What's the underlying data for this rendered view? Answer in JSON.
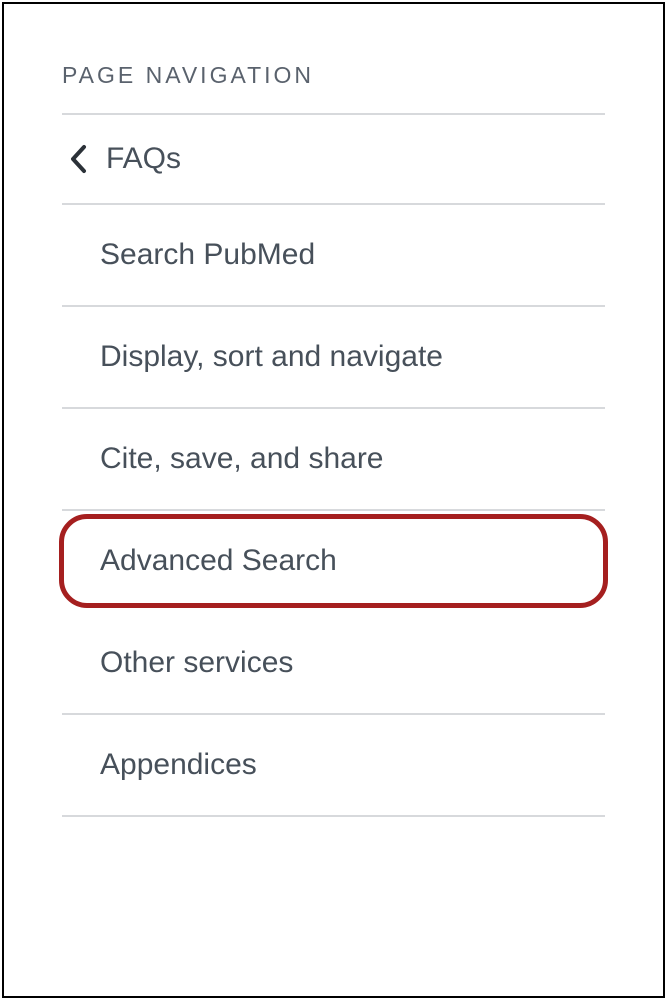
{
  "nav": {
    "title": "PAGE NAVIGATION",
    "parent": {
      "label": "FAQs"
    },
    "items": [
      {
        "label": "Search PubMed"
      },
      {
        "label": "Display, sort and navigate"
      },
      {
        "label": "Cite, save, and share"
      },
      {
        "label": "Advanced Search",
        "highlighted": true
      },
      {
        "label": "Other services"
      },
      {
        "label": "Appendices"
      }
    ]
  }
}
